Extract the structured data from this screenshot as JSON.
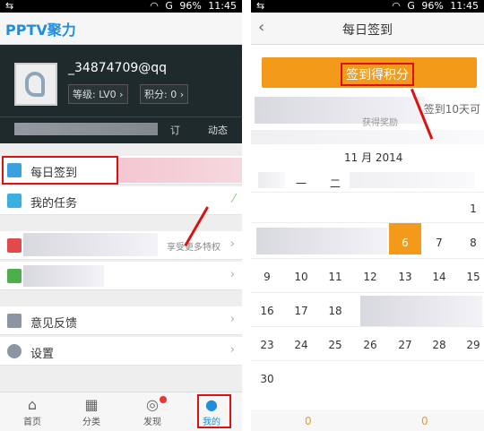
{
  "status": {
    "battery": "96%",
    "time": "11:45",
    "signal": "G"
  },
  "left": {
    "brand": "PPTV聚力",
    "username": "_34874709@qq",
    "level_label": "等级: LV0",
    "points_label": "积分: 0",
    "tail_char": "订",
    "feed_label": "动态",
    "menu": [
      {
        "label": "每日签到"
      },
      {
        "label": "我的任务"
      },
      {
        "label": "享受更多特权"
      },
      {
        "label": ""
      },
      {
        "label": "意见反馈"
      },
      {
        "label": "设置"
      }
    ],
    "tabs": [
      {
        "label": "首页",
        "icon": "home-icon"
      },
      {
        "label": "分类",
        "icon": "grid-icon"
      },
      {
        "label": "发现",
        "icon": "discover-icon"
      },
      {
        "label": "我的",
        "icon": "profile-icon"
      }
    ]
  },
  "right": {
    "title": "每日签到",
    "sign_button": "签到得积分",
    "days_note": "签到10天可",
    "hint": "获得奖励",
    "month": "11 月 2014",
    "weekdays": [
      "一",
      "二"
    ],
    "dates": {
      "row1": [
        "1"
      ],
      "row2": [
        "6",
        "7",
        "8"
      ],
      "row3": [
        "9",
        "10",
        "11",
        "12",
        "13",
        "14",
        "15"
      ],
      "row4": [
        "16",
        "17",
        "18"
      ],
      "row5": [
        "23",
        "24",
        "25",
        "26",
        "27",
        "28",
        "29"
      ],
      "row6": [
        "30"
      ]
    },
    "footer_num": "0"
  },
  "colors": {
    "accent": "#f39a1b",
    "highlight": "#dd1111",
    "brand": "#1d8ee0"
  }
}
